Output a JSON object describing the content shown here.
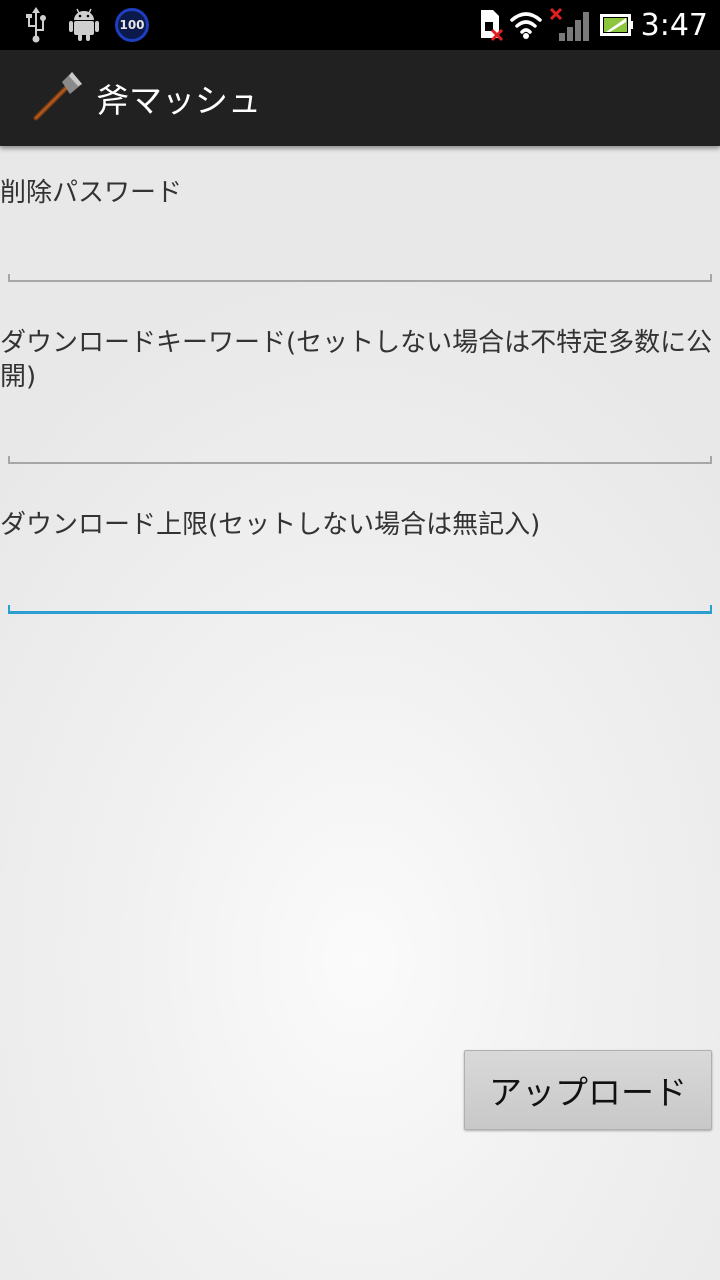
{
  "status_bar": {
    "badge_text": "100",
    "clock": "3:47",
    "icons": [
      "usb-icon",
      "android-debug-icon",
      "badge-100-icon",
      "sim-error-icon",
      "wifi-icon",
      "signal-no-data-icon",
      "battery-charging-icon"
    ]
  },
  "action_bar": {
    "app_icon": "axe-icon",
    "title": "斧マッシュ",
    "background": "#212121"
  },
  "form": {
    "delete_password_label": "削除パスワード",
    "delete_password_value": "",
    "download_keyword_label": "ダウンロードキーワード(セットしない場合は不特定多数に公開)",
    "download_keyword_value": "",
    "download_limit_label": "ダウンロード上限(セットしない場合は無記入)",
    "download_limit_value": "",
    "focus_color": "#2a9fd0"
  },
  "upload_button": {
    "label": "アップロード"
  }
}
